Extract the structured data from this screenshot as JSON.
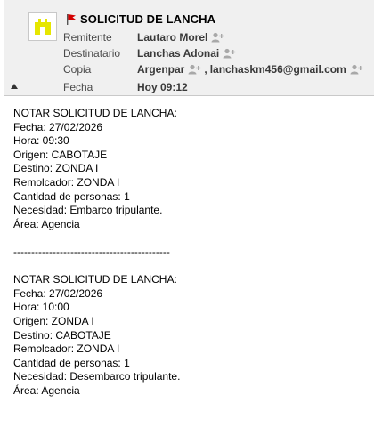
{
  "header": {
    "subject": "SOLICITUD DE LANCHA",
    "fields": {
      "from_label": "Remitente",
      "from_value": "Lautaro Morel",
      "to_label": "Destinatario",
      "to_value": "Lanchas Adonai",
      "cc_label": "Copia",
      "cc_value_1": "Argenpar",
      "cc_sep": ",",
      "cc_value_2": "lanchaskm456@gmail.com",
      "date_label": "Fecha",
      "date_value": "Hoy 09:12"
    }
  },
  "body": {
    "lines": [
      "NOTAR SOLICITUD DE LANCHA:",
      "Fecha: 27/02/2026",
      "Hora: 09:30",
      "Origen: CABOTAJE",
      "Destino: ZONDA I",
      "Remolcador: ZONDA I",
      "Cantidad de personas: 1",
      "Necesidad: Embarco tripulante.",
      "Área: Agencia",
      "",
      "--------------------------------------------",
      "",
      "NOTAR SOLICITUD DE LANCHA:",
      "Fecha: 27/02/2026",
      "Hora: 10:00",
      "Origen: ZONDA I",
      "Destino: CABOTAJE",
      "Remolcador: ZONDA I",
      "Cantidad de personas: 1",
      "Necesidad: Desembarco tripulante.",
      "Área: Agencia"
    ]
  },
  "icons": {
    "avatar": "castle-avatar-icon",
    "flag": "red-flag-icon",
    "contact": "add-contact-icon",
    "collapse": "collapse-triangle-icon"
  },
  "colors": {
    "header_bg": "#f0f0f0",
    "avatar_yellow": "#e6e600",
    "flag_red": "#d40000",
    "label_gray": "#4a4a4a"
  }
}
